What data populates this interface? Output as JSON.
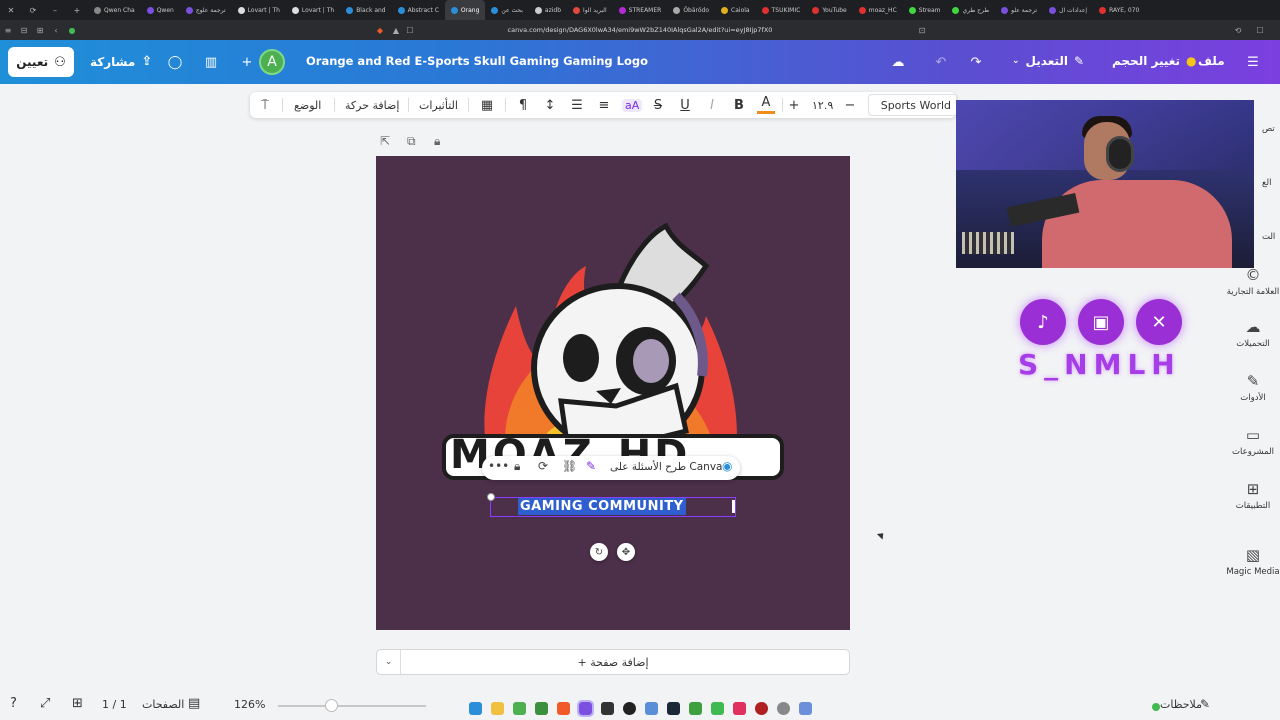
{
  "browser": {
    "tabs": [
      {
        "label": "Qwen Cha"
      },
      {
        "label": "Qwen"
      },
      {
        "label": "ترجمة علوج"
      },
      {
        "label": "Lovart | Th"
      },
      {
        "label": "Lovart | Th"
      },
      {
        "label": "Black and"
      },
      {
        "label": "Abstract C"
      },
      {
        "label": "Orang",
        "active": true
      },
      {
        "label": "بحث عن"
      },
      {
        "label": "azidb"
      },
      {
        "label": "البريد الوا"
      },
      {
        "label": "STREAMER"
      },
      {
        "label": "Öbärödo"
      },
      {
        "label": "Caiola"
      },
      {
        "label": "TSUKIMIC"
      },
      {
        "label": "YouTube"
      },
      {
        "label": "moaz_HC"
      },
      {
        "label": "Stream"
      },
      {
        "label": "طرح طري"
      },
      {
        "label": "ترجمة علو"
      },
      {
        "label": "إعدادات ال"
      },
      {
        "label": "RAYE, 070"
      }
    ],
    "url": "canva.com/design/DAG6X0lwA34/emi9wW2bZ140IAlqsGal2A/edit?ui=eyJ8Ijp7fX0"
  },
  "header": {
    "assign_label": "تعيين",
    "share_label": "مشاركة",
    "avatar_letter": "A",
    "add_label": "+",
    "doc_title": "Orange and Red E-Sports Skull Gaming Gaming Logo",
    "edit_label": "التعديل",
    "resize_label": "تغيير الحجم",
    "file_label": "ملف"
  },
  "toolbar": {
    "position_label": "الوضع",
    "animate_label": "إضافة حركة",
    "effects_label": "التأثيرات",
    "font_size": "١٢.٩",
    "plus": "+",
    "minus": "−",
    "font_name": "Sports World",
    "bold": "B",
    "italic": "I",
    "underline": "U",
    "strike": "S",
    "case": "aA",
    "color": "A"
  },
  "canvas": {
    "logo_name": "MOAZ_HD",
    "ask_canva": "طرح الأسئلة على Canva",
    "subtitle": "GAMING COMMUNITY"
  },
  "addpage": {
    "label": "+ إضافة صفحة"
  },
  "overlay": {
    "social_labels": [
      "TikTok",
      "Twitch",
      "X"
    ],
    "streamer_name": "S_NMLH"
  },
  "sidebar": {
    "items": [
      {
        "label": "العلامة التجارية",
        "icon": "brand-icon"
      },
      {
        "label": "التحميلات",
        "icon": "upload-icon"
      },
      {
        "label": "الأدوات",
        "icon": "tools-icon"
      },
      {
        "label": "المشروعات",
        "icon": "folder-icon"
      },
      {
        "label": "التطبيقات",
        "icon": "apps-icon"
      },
      {
        "label": "Magic Media",
        "icon": "magic-icon"
      }
    ],
    "partial_labels": [
      "تص",
      "الع",
      "الت"
    ]
  },
  "footer": {
    "page_counter": "1 / 1",
    "pages_label": "الصفحات",
    "zoom": "126%",
    "notes_label": "ملاحظات"
  },
  "colors": {
    "canvas_bg": "#4c2f49",
    "accent": "#7d2ae8",
    "selection": "#8b3dff",
    "social": "#9b2fd6"
  }
}
